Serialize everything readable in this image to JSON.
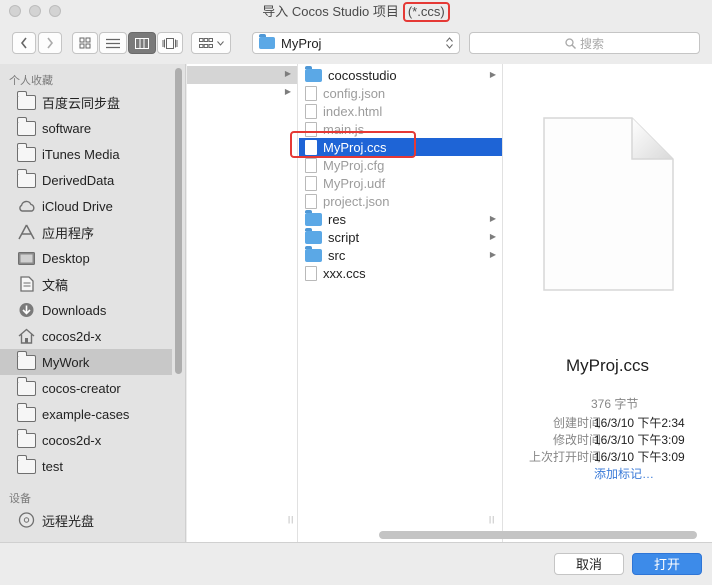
{
  "window": {
    "title": "导入 Cocos Studio 项目",
    "filter": "(*.ccs)"
  },
  "toolbar": {
    "back_icon": "chevron-left",
    "forward_icon": "chevron-right",
    "view_icon": "icon-view",
    "list_icon": "list-view",
    "column_icon": "column-view",
    "flow_icon": "cover-flow-view",
    "arrange_icon": "arrange-menu",
    "path": "MyProj",
    "search_placeholder": "搜索"
  },
  "sidebar": {
    "favorites_header": "个人收藏",
    "favorites": [
      {
        "label": "百度云同步盘",
        "icon": "folder"
      },
      {
        "label": "software",
        "icon": "folder"
      },
      {
        "label": "iTunes Media",
        "icon": "folder"
      },
      {
        "label": "DerivedData",
        "icon": "folder"
      },
      {
        "label": "iCloud Drive",
        "icon": "cloud"
      },
      {
        "label": "应用程序",
        "icon": "applications"
      },
      {
        "label": "Desktop",
        "icon": "desktop"
      },
      {
        "label": "文稿",
        "icon": "document"
      },
      {
        "label": "Downloads",
        "icon": "download"
      },
      {
        "label": "cocos2d-x",
        "icon": "home"
      },
      {
        "label": "MyWork",
        "icon": "folder"
      },
      {
        "label": "cocos-creator",
        "icon": "folder"
      },
      {
        "label": "example-cases",
        "icon": "folder"
      },
      {
        "label": "cocos2d-x",
        "icon": "folder"
      },
      {
        "label": "test",
        "icon": "folder"
      }
    ],
    "selected_index": 10,
    "devices_header": "设备",
    "devices": [
      {
        "label": "远程光盘",
        "icon": "disc"
      }
    ]
  },
  "files": [
    {
      "name": "cocosstudio",
      "type": "folder",
      "dim": false
    },
    {
      "name": "config.json",
      "type": "file",
      "dim": true
    },
    {
      "name": "index.html",
      "type": "file",
      "dim": true
    },
    {
      "name": "main.js",
      "type": "file",
      "dim": true
    },
    {
      "name": "MyProj.ccs",
      "type": "file",
      "dim": false
    },
    {
      "name": "MyProj.cfg",
      "type": "file",
      "dim": true
    },
    {
      "name": "MyProj.udf",
      "type": "file",
      "dim": true
    },
    {
      "name": "project.json",
      "type": "file",
      "dim": true
    },
    {
      "name": "res",
      "type": "folder",
      "dim": false
    },
    {
      "name": "script",
      "type": "folder",
      "dim": false
    },
    {
      "name": "src",
      "type": "folder",
      "dim": false
    },
    {
      "name": "xxx.ccs",
      "type": "file",
      "dim": false
    }
  ],
  "selected_file_index": 4,
  "preview": {
    "name": "MyProj.ccs",
    "size": "376 字节",
    "meta": [
      {
        "label": "创建时间",
        "value": "16/3/10 下午2:34"
      },
      {
        "label": "修改时间",
        "value": "16/3/10 下午3:09"
      },
      {
        "label": "上次打开时间",
        "value": "16/3/10 下午3:09"
      }
    ],
    "add_tags": "添加标记…"
  },
  "buttons": {
    "cancel": "取消",
    "open": "打开"
  },
  "colors": {
    "selection": "#1e64d6",
    "annotation": "#e53935",
    "folder": "#5ba8e6",
    "primary_button": "#3d8be9"
  }
}
